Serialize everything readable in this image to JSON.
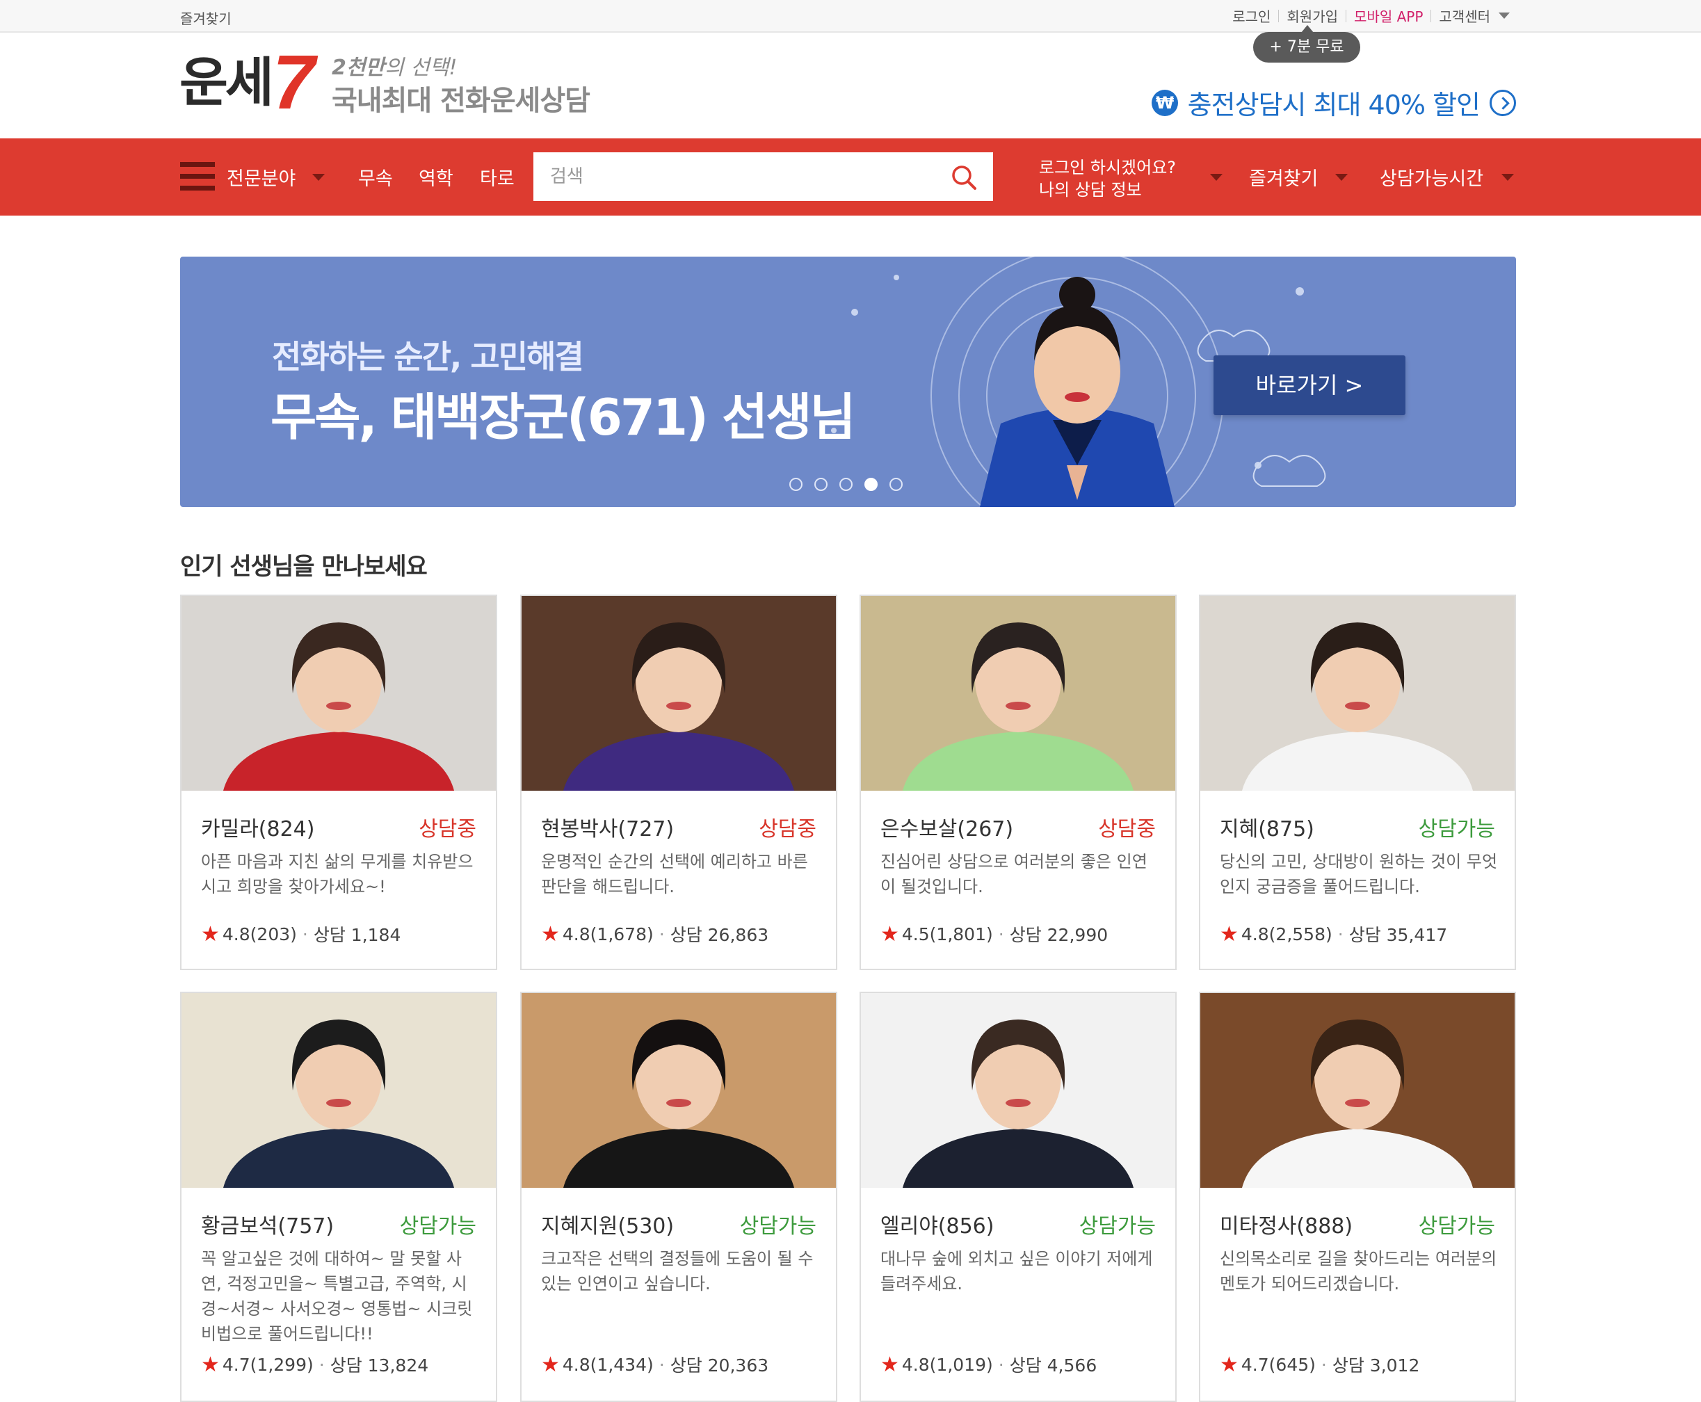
{
  "topbar": {
    "favorites": "즐겨찾기",
    "login": "로그인",
    "signup": "회원가입",
    "mobile_app": "모바일 APP",
    "support": "고객센터",
    "signup_badge": "+ 7분 무료"
  },
  "header": {
    "logo_text": "운세",
    "logo_number": "7",
    "tagline_line1_bold": "2천만",
    "tagline_line1_rest": "의 선택!",
    "tagline_line2": "국내최대 전화운세상담",
    "promo_icon": "₩",
    "promo_text": "충전상담시 최대 40% 할인"
  },
  "nav": {
    "category_label": "전문분야",
    "menu": [
      "무속",
      "역학",
      "타로"
    ],
    "search_placeholder": "검색",
    "login_prompt": "로그인 하시겠어요?",
    "my_info": "나의 상담 정보",
    "favorites": "즐겨찾기",
    "available_time": "상담가능시간"
  },
  "banner": {
    "subtitle": "전화하는 순간, 고민해결",
    "title": "무속, 태백장군(671) 선생님",
    "button": "바로가기 >",
    "slide_count": 5,
    "active_slide": 4
  },
  "section": {
    "title": "인기 선생님을 만나보세요"
  },
  "teachers": [
    {
      "name": "카밀라(824)",
      "status": "상담중",
      "status_type": "busy",
      "desc": "아픈 마음과 지친 삶의 무게를 치유받으시고 희망을 찾아가세요~!",
      "rating": "4.8(203)",
      "consults": "상담 1,184",
      "bg": "#d9d6d2",
      "cloth": "#c8232a",
      "hair": "#3a2820"
    },
    {
      "name": "현봉박사(727)",
      "status": "상담중",
      "status_type": "busy",
      "desc": "운명적인 순간의 선택에 예리하고 바른 판단을 해드립니다.",
      "rating": "4.8(1,678)",
      "consults": "상담 26,863",
      "bg": "#5a3a2a",
      "cloth": "#3f2a80",
      "hair": "#2a1d18"
    },
    {
      "name": "은수보살(267)",
      "status": "상담중",
      "status_type": "busy",
      "desc": "진심어린 상담으로 여러분의 좋은 인연이 될것입니다.",
      "rating": "4.5(1,801)",
      "consults": "상담 22,990",
      "bg": "#c9b98f",
      "cloth": "#9fdc90",
      "hair": "#2a2220"
    },
    {
      "name": "지혜(875)",
      "status": "상담가능",
      "status_type": "avail",
      "desc": "당신의 고민, 상대방이 원하는 것이 무엇인지 궁금증을 풀어드립니다.",
      "rating": "4.8(2,558)",
      "consults": "상담 35,417",
      "bg": "#dcd7d0",
      "cloth": "#f4f4f4",
      "hair": "#2a1e18"
    },
    {
      "name": "황금보석(757)",
      "status": "상담가능",
      "status_type": "avail",
      "desc": "꼭 알고싶은 것에 대하여~ 말 못할 사연, 걱정고민을~ 특별고급, 주역학, 시경~서경~ 사서오경~ 영통법~ 시크릿 비법으로 풀어드립니다!!",
      "rating": "4.7(1,299)",
      "consults": "상담 13,824",
      "bg": "#e8e2d2",
      "cloth": "#1e2a44",
      "hair": "#1c1c1c"
    },
    {
      "name": "지혜지원(530)",
      "status": "상담가능",
      "status_type": "avail",
      "desc": "크고작은 선택의 결정들에 도움이 될 수 있는 인연이고 싶습니다.",
      "rating": "4.8(1,434)",
      "consults": "상담 20,363",
      "bg": "#c99a6a",
      "cloth": "#161616",
      "hair": "#141010"
    },
    {
      "name": "엘리야(856)",
      "status": "상담가능",
      "status_type": "avail",
      "desc": "대나무 숲에 외치고 싶은 이야기 저에게 들려주세요.",
      "rating": "4.8(1,019)",
      "consults": "상담 4,566",
      "bg": "#f2f2f2",
      "cloth": "#1c2130",
      "hair": "#3a2a22"
    },
    {
      "name": "미타정사(888)",
      "status": "상담가능",
      "status_type": "avail",
      "desc": "신의목소리로 길을 찾아드리는 여러분의 멘토가 되어드리겠습니다.",
      "rating": "4.7(645)",
      "consults": "상담 3,012",
      "bg": "#7a4a2a",
      "cloth": "#f6f6f6",
      "hair": "#3a2416"
    }
  ],
  "colors": {
    "nav_red": "#dd3b30",
    "banner_blue": "#6e89c9",
    "busy_red": "#d8352a",
    "available_green": "#3d9b3d",
    "promo_blue": "#1e6fc8",
    "mobile_pink": "#d1206a"
  }
}
